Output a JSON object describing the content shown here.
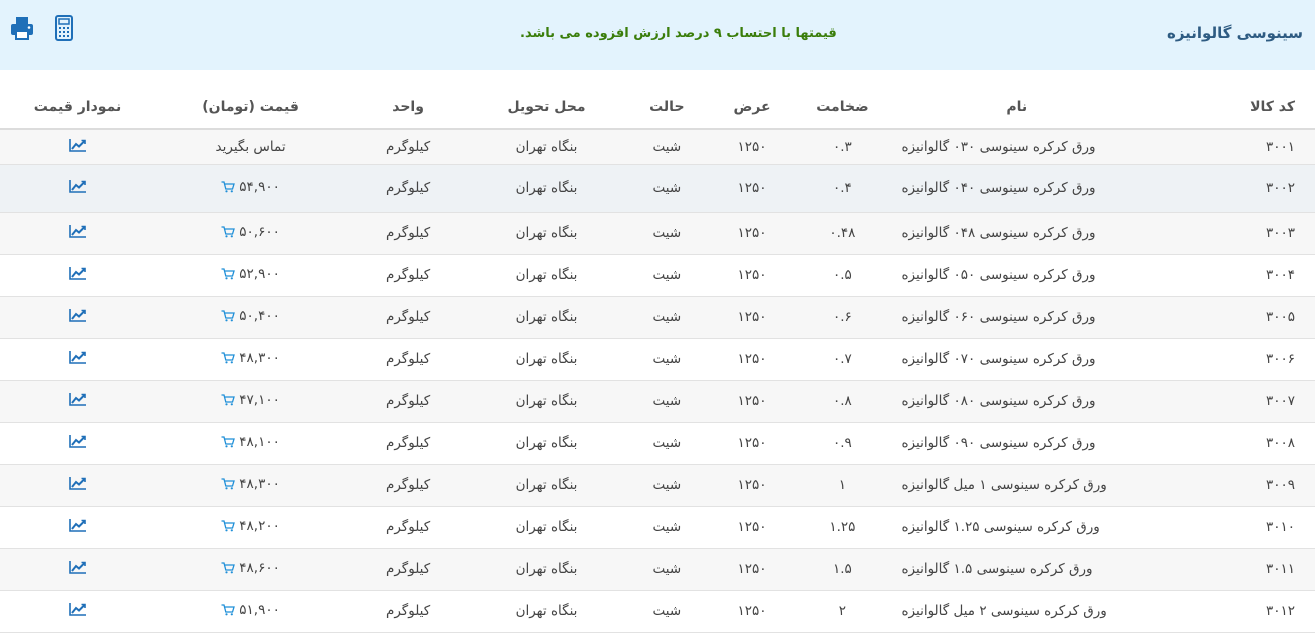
{
  "header": {
    "title": "سینوسی گالوانیزه",
    "note": "قیمتها با احتساب ۹ درصد ارزش افزوده می باشد."
  },
  "columns": {
    "code": "کد کالا",
    "name": "نام",
    "thickness": "ضخامت",
    "width": "عرض",
    "state": "حالت",
    "delivery": "محل تحویل",
    "unit": "واحد",
    "price": "قیمت (تومان)",
    "chart": "نمودار قیمت"
  },
  "colors": {
    "accent": "#2e5b82",
    "note": "#3a7d0a",
    "icon": "#1f6fb8",
    "header_bg": "#e3f3fd"
  },
  "rows": [
    {
      "code": "۳۰۰۱",
      "name": "ورق کرکره سینوسی ۰۳۰ گالوانیزه",
      "thickness": "۰.۳",
      "width": "۱۲۵۰",
      "state": "شیت",
      "delivery": "بنگاه تهران",
      "unit": "کیلوگرم",
      "price": "تماس بگیرید",
      "has_cart": false
    },
    {
      "code": "۳۰۰۲",
      "name": "ورق کرکره سینوسی ۰۴۰ گالوانیزه",
      "thickness": "۰.۴",
      "width": "۱۲۵۰",
      "state": "شیت",
      "delivery": "بنگاه تهران",
      "unit": "کیلوگرم",
      "price": "۵۴,۹۰۰",
      "has_cart": true
    },
    {
      "code": "۳۰۰۳",
      "name": "ورق کرکره سینوسی ۰۴۸ گالوانیزه",
      "thickness": "۰.۴۸",
      "width": "۱۲۵۰",
      "state": "شیت",
      "delivery": "بنگاه تهران",
      "unit": "کیلوگرم",
      "price": "۵۰,۶۰۰",
      "has_cart": true
    },
    {
      "code": "۳۰۰۴",
      "name": "ورق کرکره سینوسی ۰۵۰ گالوانیزه",
      "thickness": "۰.۵",
      "width": "۱۲۵۰",
      "state": "شیت",
      "delivery": "بنگاه تهران",
      "unit": "کیلوگرم",
      "price": "۵۲,۹۰۰",
      "has_cart": true
    },
    {
      "code": "۳۰۰۵",
      "name": "ورق کرکره سینوسی ۰۶۰ گالوانیزه",
      "thickness": "۰.۶",
      "width": "۱۲۵۰",
      "state": "شیت",
      "delivery": "بنگاه تهران",
      "unit": "کیلوگرم",
      "price": "۵۰,۴۰۰",
      "has_cart": true
    },
    {
      "code": "۳۰۰۶",
      "name": "ورق کرکره سینوسی ۰۷۰ گالوانیزه",
      "thickness": "۰.۷",
      "width": "۱۲۵۰",
      "state": "شیت",
      "delivery": "بنگاه تهران",
      "unit": "کیلوگرم",
      "price": "۴۸,۳۰۰",
      "has_cart": true
    },
    {
      "code": "۳۰۰۷",
      "name": "ورق کرکره سینوسی ۰۸۰ گالوانیزه",
      "thickness": "۰.۸",
      "width": "۱۲۵۰",
      "state": "شیت",
      "delivery": "بنگاه تهران",
      "unit": "کیلوگرم",
      "price": "۴۷,۱۰۰",
      "has_cart": true
    },
    {
      "code": "۳۰۰۸",
      "name": "ورق کرکره سینوسی ۰۹۰ گالوانیزه",
      "thickness": "۰.۹",
      "width": "۱۲۵۰",
      "state": "شیت",
      "delivery": "بنگاه تهران",
      "unit": "کیلوگرم",
      "price": "۴۸,۱۰۰",
      "has_cart": true
    },
    {
      "code": "۳۰۰۹",
      "name": "ورق کرکره سینوسی ۱ میل گالوانیزه",
      "thickness": "۱",
      "width": "۱۲۵۰",
      "state": "شیت",
      "delivery": "بنگاه تهران",
      "unit": "کیلوگرم",
      "price": "۴۸,۳۰۰",
      "has_cart": true
    },
    {
      "code": "۳۰۱۰",
      "name": "ورق کرکره سینوسی ۱.۲۵ گالوانیزه",
      "thickness": "۱.۲۵",
      "width": "۱۲۵۰",
      "state": "شیت",
      "delivery": "بنگاه تهران",
      "unit": "کیلوگرم",
      "price": "۴۸,۲۰۰",
      "has_cart": true
    },
    {
      "code": "۳۰۱۱",
      "name": "ورق کرکره سینوسی ۱.۵ گالوانیزه",
      "thickness": "۱.۵",
      "width": "۱۲۵۰",
      "state": "شیت",
      "delivery": "بنگاه تهران",
      "unit": "کیلوگرم",
      "price": "۴۸,۶۰۰",
      "has_cart": true
    },
    {
      "code": "۳۰۱۲",
      "name": "ورق کرکره سینوسی ۲ میل گالوانیزه",
      "thickness": "۲",
      "width": "۱۲۵۰",
      "state": "شیت",
      "delivery": "بنگاه تهران",
      "unit": "کیلوگرم",
      "price": "۵۱,۹۰۰",
      "has_cart": true
    }
  ]
}
